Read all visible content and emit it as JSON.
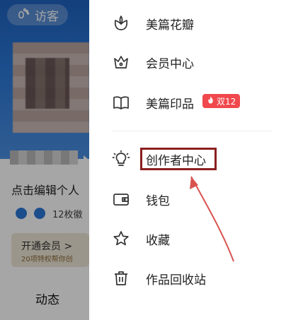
{
  "background": {
    "visitor_label": "访客",
    "edit_hint": "点击编辑个人",
    "badge_text": "12枚徽",
    "vip_title": "开通会员 >",
    "vip_subtitle": "20项特权帮你创",
    "tab_label": "动态"
  },
  "menu": {
    "items": [
      {
        "label": "美篇花瓣",
        "icon": "petal-icon"
      },
      {
        "label": "会员中心",
        "icon": "crown-icon"
      },
      {
        "label": "美篇印品",
        "icon": "book-icon",
        "badge": "双12"
      },
      {
        "label": "创作者中心",
        "icon": "lightbulb-icon",
        "highlighted": true
      },
      {
        "label": "钱包",
        "icon": "wallet-icon"
      },
      {
        "label": "收藏",
        "icon": "star-icon"
      },
      {
        "label": "作品回收站",
        "icon": "trash-icon"
      }
    ]
  },
  "colors": {
    "accent_blue": "#2b78d8",
    "highlight_border": "#8b1f1f",
    "promo_badge": "#f0484c",
    "arrow": "#d9534f"
  }
}
